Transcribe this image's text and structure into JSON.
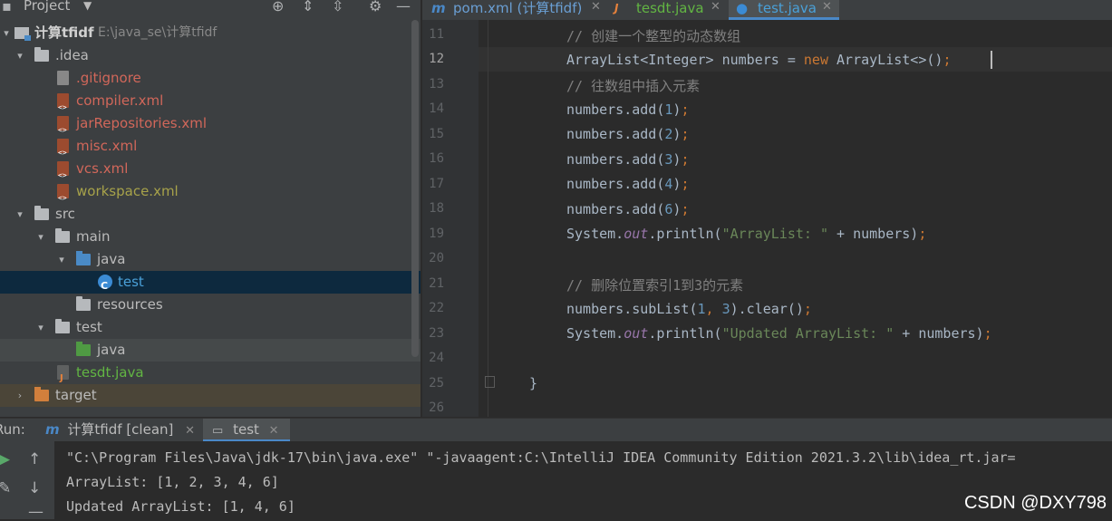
{
  "project_panel": {
    "title": "Project",
    "tree": [
      {
        "label": "计算tfidf",
        "path": "E:\\java_se\\计算tfidf"
      },
      {
        "label": ".idea"
      },
      {
        "label": ".gitignore"
      },
      {
        "label": "compiler.xml"
      },
      {
        "label": "jarRepositories.xml"
      },
      {
        "label": "misc.xml"
      },
      {
        "label": "vcs.xml"
      },
      {
        "label": "workspace.xml"
      },
      {
        "label": "src"
      },
      {
        "label": "main"
      },
      {
        "label": "java"
      },
      {
        "label": "test"
      },
      {
        "label": "resources"
      },
      {
        "label": "test"
      },
      {
        "label": "java"
      },
      {
        "label": "tesdt.java"
      },
      {
        "label": "target"
      }
    ]
  },
  "editor_tabs": [
    {
      "label": "pom.xml (计算tfidf)",
      "icon": "maven-icon"
    },
    {
      "label": "tesdt.java",
      "icon": "java-file-icon"
    },
    {
      "label": "test.java",
      "icon": "java-class-icon",
      "active": true
    }
  ],
  "editor": {
    "line_numbers": [
      "11",
      "12",
      "13",
      "14",
      "15",
      "16",
      "17",
      "18",
      "19",
      "20",
      "21",
      "22",
      "23",
      "24",
      "25",
      "26"
    ],
    "current_line": "12",
    "lines": [
      "// 创建一个整型的动态数组",
      "ArrayList<Integer> numbers = new ArrayList<>();",
      "// 往数组中插入元素",
      "numbers.add(1);",
      "numbers.add(2);",
      "numbers.add(3);",
      "numbers.add(4);",
      "numbers.add(6);",
      "System.out.println(\"ArrayList: \" + numbers);",
      "",
      "// 删除位置索引1到3的元素",
      "numbers.subList(1, 3).clear();",
      "System.out.println(\"Updated ArrayList: \" + numbers);",
      "",
      "}",
      ""
    ]
  },
  "run_panel": {
    "label": "Run:",
    "tabs": [
      {
        "label": "计算tfidf [clean]"
      },
      {
        "label": "test",
        "active": true
      }
    ],
    "console": [
      "\"C:\\Program Files\\Java\\jdk-17\\bin\\java.exe\" \"-javaagent:C:\\IntelliJ IDEA Community Edition 2021.3.2\\lib\\idea_rt.jar=",
      "ArrayList: [1, 2, 3, 4, 6]",
      "Updated ArrayList: [1, 4, 6]"
    ]
  },
  "watermark": "CSDN @DXY798",
  "colors": {
    "accent": "#4a88c7",
    "selection": "#0d293e",
    "keyword": "#cc7832",
    "string": "#6a8759",
    "number": "#6897bb"
  }
}
